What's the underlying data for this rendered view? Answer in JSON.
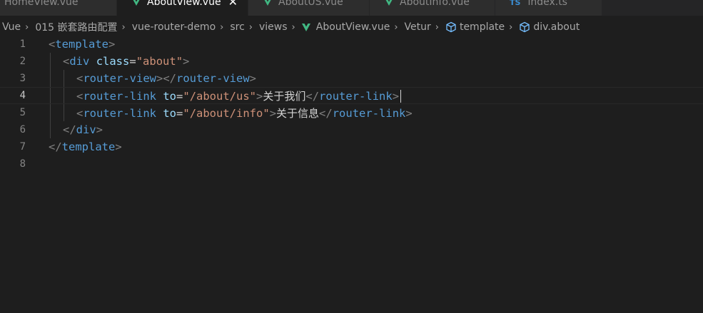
{
  "tabs": [
    {
      "label": "HomeView.vue",
      "icon": "vue-icon",
      "active": false
    },
    {
      "label": "AboutView.vue",
      "icon": "vue-icon",
      "active": true,
      "close": "✕"
    },
    {
      "label": "AboutUS.vue",
      "icon": "vue-icon",
      "active": false
    },
    {
      "label": "AboutInfo.vue",
      "icon": "vue-icon",
      "active": false
    },
    {
      "label": "index.ts",
      "icon": "ts-icon",
      "icon_text": "TS",
      "active": false
    }
  ],
  "breadcrumb": {
    "items": [
      "Vue",
      "015 嵌套路由配置",
      "vue-router-demo",
      "src",
      "views",
      "AboutView.vue",
      "Vetur",
      "template",
      "div.about"
    ],
    "separator": "›"
  },
  "editor": {
    "current_line": 4,
    "line_numbers": [
      "1",
      "2",
      "3",
      "4",
      "5",
      "6",
      "7",
      "8"
    ],
    "tokens": {
      "lt": "<",
      "gt": ">",
      "lt_slash": "</",
      "template": "template",
      "div": "div",
      "class_attr": "class",
      "eq": "=",
      "about_str": "\"about\"",
      "router_view": "router-view",
      "router_link": "router-link",
      "to_attr": "to",
      "us_str": "\"/about/us\"",
      "info_str": "\"/about/info\"",
      "us_text": "关于我们",
      "info_text": "关于信息"
    }
  },
  "colors": {
    "background": "#1e1e1e",
    "tag": "#569cd6",
    "attribute": "#9cdcfe",
    "string": "#ce9178",
    "punctuation": "#808080",
    "vue_green": "#41b883"
  }
}
